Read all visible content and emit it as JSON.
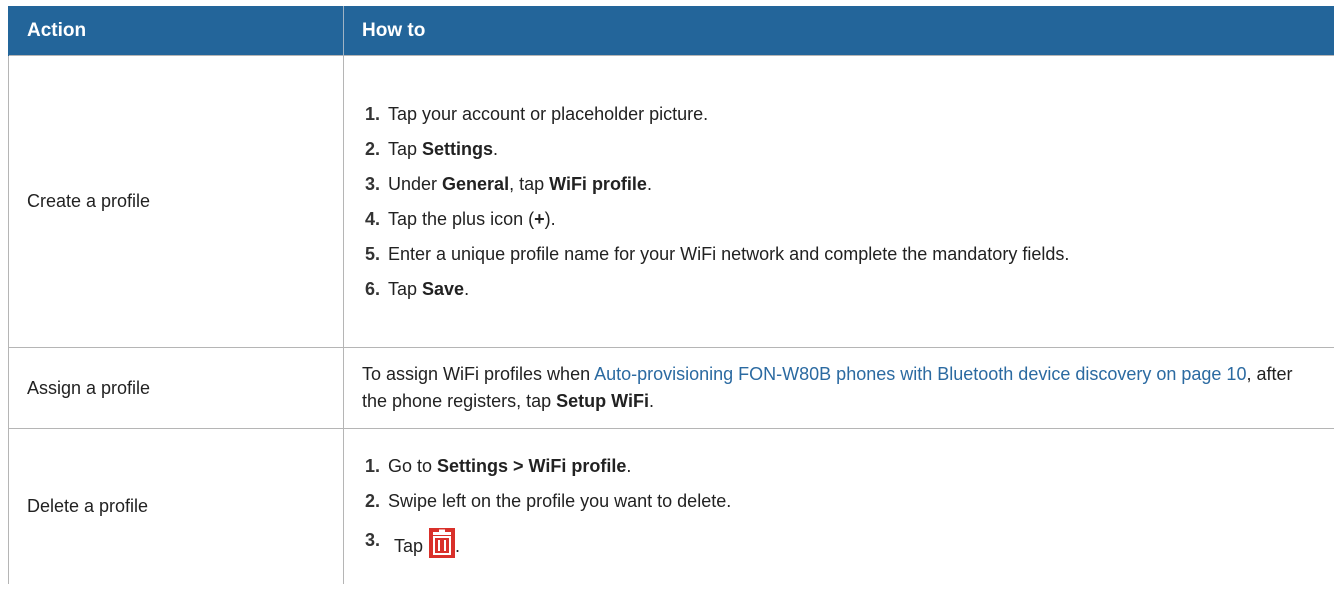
{
  "header": {
    "action": "Action",
    "how_to": "How to"
  },
  "rows": [
    {
      "action": "Create a profile",
      "steps": [
        {
          "num": "1.",
          "t1": "Tap your account or placeholder picture."
        },
        {
          "num": "2.",
          "t1": "Tap ",
          "b1": "Settings",
          "t2": "."
        },
        {
          "num": "3.",
          "t1": "Under ",
          "b1": "General",
          "t2": ", tap ",
          "b2": "WiFi profile",
          "t3": "."
        },
        {
          "num": "4.",
          "t1": "Tap the plus icon (",
          "b1": "+",
          "t2": ")."
        },
        {
          "num": "5.",
          "t1": "Enter a unique profile name for your WiFi network and complete the mandatory fields."
        },
        {
          "num": "6.",
          "t1": "Tap ",
          "b1": "Save",
          "t2": "."
        }
      ]
    },
    {
      "action": "Assign a profile",
      "t1": "To assign WiFi profiles when ",
      "link": "Auto-provisioning FON-W80B phones with Bluetooth device discovery on page 10",
      "t2": ", after the phone registers, tap ",
      "b1": "Setup WiFi",
      "t3": "."
    },
    {
      "action": "Delete a profile",
      "steps": [
        {
          "num": "1.",
          "t1": "Go to ",
          "b1": "Settings > WiFi profile",
          "t2": "."
        },
        {
          "num": "2.",
          "t1": "Swipe left on the profile you want to delete."
        },
        {
          "num": "3.",
          "t1": "Tap",
          "icon": "trash-icon",
          "t2": "."
        }
      ]
    }
  ],
  "colors": {
    "header_bg": "#23659a",
    "link": "#2b6aa1",
    "trash": "#d9302a"
  }
}
